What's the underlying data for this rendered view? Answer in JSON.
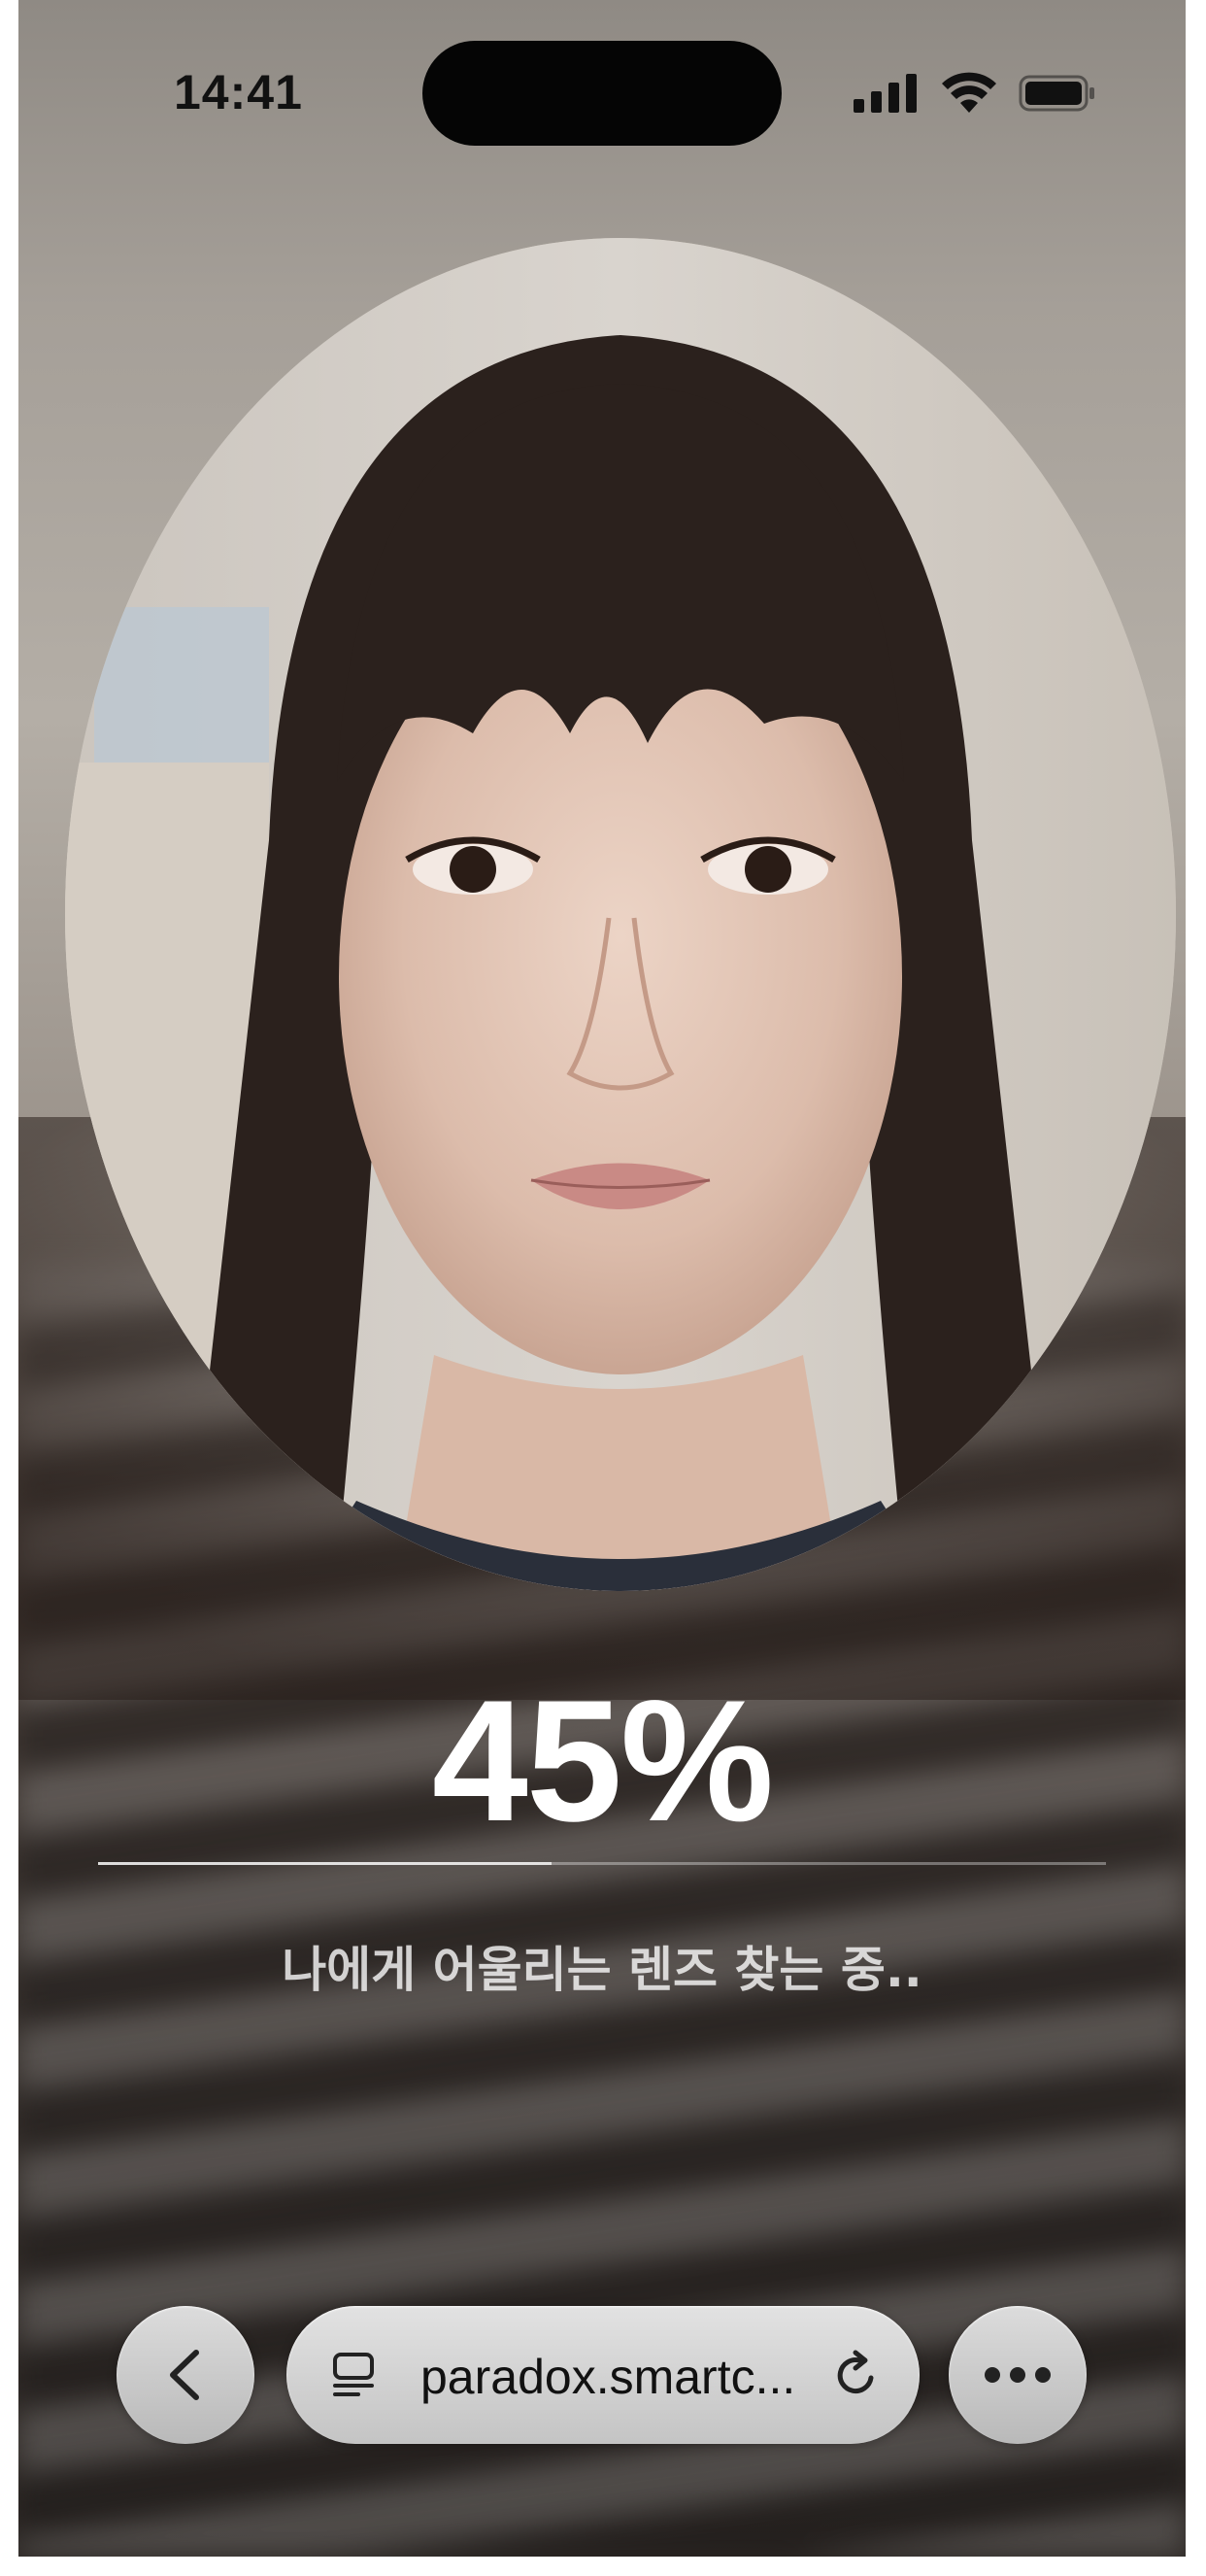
{
  "status_bar": {
    "time": "14:41"
  },
  "analysis": {
    "percent_text": "45%",
    "progress": 0.45,
    "message": "나에게 어울리는 렌즈 찾는 중.."
  },
  "browser_toolbar": {
    "url": "paradox.smartc..."
  },
  "icons": {
    "back": "chevron-left-icon",
    "page_menu": "page-menu-icon",
    "reload": "reload-icon",
    "more": "more-icon"
  }
}
